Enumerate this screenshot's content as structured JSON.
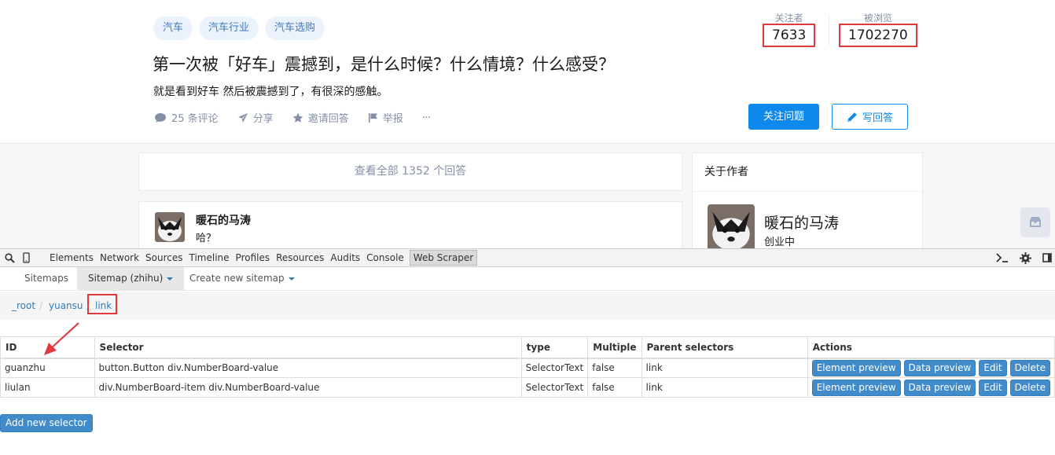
{
  "question": {
    "topics": [
      "汽车",
      "汽车行业",
      "汽车选购"
    ],
    "title": "第一次被「好车」震撼到，是什么时候？什么情境？什么感受？",
    "detail": "就是看到好车 然后被震撼到了，有很深的感触。",
    "actions": {
      "comments": "25 条评论",
      "share": "分享",
      "invite": "邀请回答",
      "report": "举报",
      "more": "···"
    },
    "followers_label": "关注者",
    "followers_value": "7633",
    "views_label": "被浏览",
    "views_value": "1702270",
    "follow_button": "关注问题",
    "write_button": "写回答"
  },
  "answers": {
    "view_all": "查看全部 1352 个回答",
    "first": {
      "author": "暖石的马涛",
      "bio": "哈？"
    }
  },
  "author_card": {
    "heading": "关于作者",
    "name": "暖石的马涛",
    "bio": "创业中"
  },
  "devtools": {
    "tabs": [
      "Elements",
      "Network",
      "Sources",
      "Timeline",
      "Profiles",
      "Resources",
      "Audits",
      "Console",
      "Web Scraper"
    ],
    "active_tab": "Web Scraper"
  },
  "webscraper": {
    "nav": {
      "sitemaps": "Sitemaps",
      "current_sitemap": "Sitemap (zhihu)",
      "create": "Create new sitemap"
    },
    "breadcrumb": [
      "_root",
      "yuansu",
      "link"
    ],
    "table": {
      "headers": [
        "ID",
        "Selector",
        "type",
        "Multiple",
        "Parent selectors",
        "Actions"
      ],
      "rows": [
        {
          "id": "guanzhu",
          "selector": "button.Button div.NumberBoard-value",
          "type": "SelectorText",
          "multiple": "false",
          "parent": "link"
        },
        {
          "id": "liulan",
          "selector": "div.NumberBoard-item div.NumberBoard-value",
          "type": "SelectorText",
          "multiple": "false",
          "parent": "link"
        }
      ],
      "action_labels": {
        "element_preview": "Element preview",
        "data_preview": "Data preview",
        "edit": "Edit",
        "delete": "Delete"
      }
    },
    "add_selector": "Add new selector"
  },
  "colors": {
    "highlight": "#e03a3e",
    "zhihu_blue": "#0f88eb",
    "bootstrap_primary": "#428bca"
  }
}
